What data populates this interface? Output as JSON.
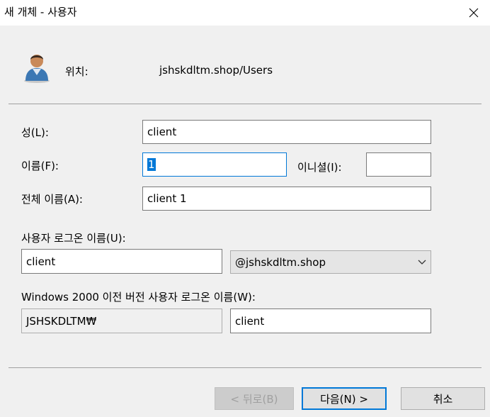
{
  "window": {
    "title": "새 개체 - 사용자"
  },
  "location": {
    "label": "위치:",
    "value": "jshskdltm.shop/Users"
  },
  "form": {
    "last_name_label": "성(L):",
    "last_name_value": "client",
    "first_name_label": "이름(F):",
    "first_name_value": "1",
    "initials_label": "이니셜(I):",
    "initials_value": "",
    "full_name_label": "전체 이름(A):",
    "full_name_value": "client 1",
    "logon_label": "사용자 로그온 이름(U):",
    "logon_value": "client",
    "domain_value": "@jshskdltm.shop",
    "pre2000_label": "Windows 2000 이전 버전 사용자 로그온 이름(W):",
    "pre2000_domain": "JSHSKDLTM₩",
    "pre2000_value": "client"
  },
  "buttons": {
    "back": "< 뒤로(B)",
    "next": "다음(N) >",
    "cancel": "취소"
  },
  "icons": [
    "user-icon",
    "close-icon",
    "chevron-down-icon"
  ]
}
